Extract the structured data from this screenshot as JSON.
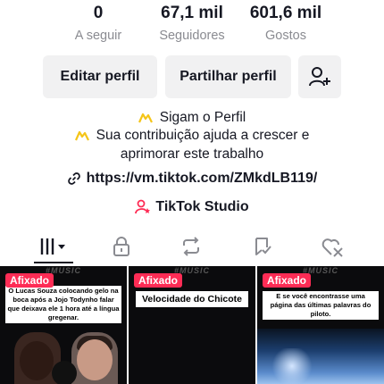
{
  "stats": {
    "following": {
      "value": "0",
      "label": "A seguir"
    },
    "followers": {
      "value": "67,1 mil",
      "label": "Seguidores"
    },
    "likes": {
      "value": "601,6 mil",
      "label": "Gostos"
    }
  },
  "actions": {
    "edit_label": "Editar perfil",
    "share_label": "Partilhar perfil",
    "add_friend_icon": "add-user-icon"
  },
  "bio": {
    "line1": "Sigam o Perfil",
    "line2": "Sua contribuição ajuda a crescer e",
    "line3": "aprimorar este trabalho",
    "bullet_icon": "yellow-sparkle-icon"
  },
  "link": {
    "url": "https://vm.tiktok.com/ZMkdLB119/"
  },
  "studio": {
    "label": "TikTok Studio"
  },
  "tabs": [
    {
      "icon": "videos-grid-icon",
      "active": true
    },
    {
      "icon": "lock-icon",
      "active": false
    },
    {
      "icon": "repost-icon",
      "active": false
    },
    {
      "icon": "favorites-icon",
      "active": false
    },
    {
      "icon": "liked-icon",
      "active": false
    }
  ],
  "videos": [
    {
      "pinned": "Afixado",
      "caption": "O Lucas Souza colocando gelo na boca após a Jojo Todynho falar que deixava ele 1 hora até a língua gregenar.",
      "watermark": "#MUSIC"
    },
    {
      "pinned": "Afixado",
      "caption": "Velocidade do Chicote",
      "watermark": "#MUSIC"
    },
    {
      "pinned": "Afixado",
      "caption": "E se você encontrasse uma página das últimas palavras do piloto.",
      "watermark": "#MUSIC"
    }
  ],
  "colors": {
    "accent": "#fe2c55",
    "text": "#161823",
    "muted": "#8a8b91",
    "button_bg": "#f1f1f2",
    "bio_icon": "#f5c518"
  }
}
